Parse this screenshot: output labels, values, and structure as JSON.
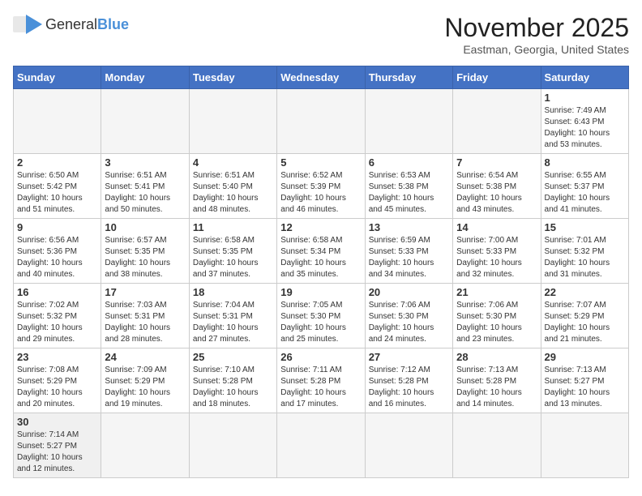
{
  "logo": {
    "text_general": "General",
    "text_blue": "Blue"
  },
  "title": "November 2025",
  "subtitle": "Eastman, Georgia, United States",
  "weekdays": [
    "Sunday",
    "Monday",
    "Tuesday",
    "Wednesday",
    "Thursday",
    "Friday",
    "Saturday"
  ],
  "weeks": [
    [
      {
        "day": "",
        "info": ""
      },
      {
        "day": "",
        "info": ""
      },
      {
        "day": "",
        "info": ""
      },
      {
        "day": "",
        "info": ""
      },
      {
        "day": "",
        "info": ""
      },
      {
        "day": "",
        "info": ""
      },
      {
        "day": "1",
        "info": "Sunrise: 7:49 AM\nSunset: 6:43 PM\nDaylight: 10 hours\nand 53 minutes."
      }
    ],
    [
      {
        "day": "2",
        "info": "Sunrise: 6:50 AM\nSunset: 5:42 PM\nDaylight: 10 hours\nand 51 minutes."
      },
      {
        "day": "3",
        "info": "Sunrise: 6:51 AM\nSunset: 5:41 PM\nDaylight: 10 hours\nand 50 minutes."
      },
      {
        "day": "4",
        "info": "Sunrise: 6:51 AM\nSunset: 5:40 PM\nDaylight: 10 hours\nand 48 minutes."
      },
      {
        "day": "5",
        "info": "Sunrise: 6:52 AM\nSunset: 5:39 PM\nDaylight: 10 hours\nand 46 minutes."
      },
      {
        "day": "6",
        "info": "Sunrise: 6:53 AM\nSunset: 5:38 PM\nDaylight: 10 hours\nand 45 minutes."
      },
      {
        "day": "7",
        "info": "Sunrise: 6:54 AM\nSunset: 5:38 PM\nDaylight: 10 hours\nand 43 minutes."
      },
      {
        "day": "8",
        "info": "Sunrise: 6:55 AM\nSunset: 5:37 PM\nDaylight: 10 hours\nand 41 minutes."
      }
    ],
    [
      {
        "day": "9",
        "info": "Sunrise: 6:56 AM\nSunset: 5:36 PM\nDaylight: 10 hours\nand 40 minutes."
      },
      {
        "day": "10",
        "info": "Sunrise: 6:57 AM\nSunset: 5:35 PM\nDaylight: 10 hours\nand 38 minutes."
      },
      {
        "day": "11",
        "info": "Sunrise: 6:58 AM\nSunset: 5:35 PM\nDaylight: 10 hours\nand 37 minutes."
      },
      {
        "day": "12",
        "info": "Sunrise: 6:58 AM\nSunset: 5:34 PM\nDaylight: 10 hours\nand 35 minutes."
      },
      {
        "day": "13",
        "info": "Sunrise: 6:59 AM\nSunset: 5:33 PM\nDaylight: 10 hours\nand 34 minutes."
      },
      {
        "day": "14",
        "info": "Sunrise: 7:00 AM\nSunset: 5:33 PM\nDaylight: 10 hours\nand 32 minutes."
      },
      {
        "day": "15",
        "info": "Sunrise: 7:01 AM\nSunset: 5:32 PM\nDaylight: 10 hours\nand 31 minutes."
      }
    ],
    [
      {
        "day": "16",
        "info": "Sunrise: 7:02 AM\nSunset: 5:32 PM\nDaylight: 10 hours\nand 29 minutes."
      },
      {
        "day": "17",
        "info": "Sunrise: 7:03 AM\nSunset: 5:31 PM\nDaylight: 10 hours\nand 28 minutes."
      },
      {
        "day": "18",
        "info": "Sunrise: 7:04 AM\nSunset: 5:31 PM\nDaylight: 10 hours\nand 27 minutes."
      },
      {
        "day": "19",
        "info": "Sunrise: 7:05 AM\nSunset: 5:30 PM\nDaylight: 10 hours\nand 25 minutes."
      },
      {
        "day": "20",
        "info": "Sunrise: 7:06 AM\nSunset: 5:30 PM\nDaylight: 10 hours\nand 24 minutes."
      },
      {
        "day": "21",
        "info": "Sunrise: 7:06 AM\nSunset: 5:30 PM\nDaylight: 10 hours\nand 23 minutes."
      },
      {
        "day": "22",
        "info": "Sunrise: 7:07 AM\nSunset: 5:29 PM\nDaylight: 10 hours\nand 21 minutes."
      }
    ],
    [
      {
        "day": "23",
        "info": "Sunrise: 7:08 AM\nSunset: 5:29 PM\nDaylight: 10 hours\nand 20 minutes."
      },
      {
        "day": "24",
        "info": "Sunrise: 7:09 AM\nSunset: 5:29 PM\nDaylight: 10 hours\nand 19 minutes."
      },
      {
        "day": "25",
        "info": "Sunrise: 7:10 AM\nSunset: 5:28 PM\nDaylight: 10 hours\nand 18 minutes."
      },
      {
        "day": "26",
        "info": "Sunrise: 7:11 AM\nSunset: 5:28 PM\nDaylight: 10 hours\nand 17 minutes."
      },
      {
        "day": "27",
        "info": "Sunrise: 7:12 AM\nSunset: 5:28 PM\nDaylight: 10 hours\nand 16 minutes."
      },
      {
        "day": "28",
        "info": "Sunrise: 7:13 AM\nSunset: 5:28 PM\nDaylight: 10 hours\nand 14 minutes."
      },
      {
        "day": "29",
        "info": "Sunrise: 7:13 AM\nSunset: 5:27 PM\nDaylight: 10 hours\nand 13 minutes."
      }
    ],
    [
      {
        "day": "30",
        "info": "Sunrise: 7:14 AM\nSunset: 5:27 PM\nDaylight: 10 hours\nand 12 minutes."
      },
      {
        "day": "",
        "info": ""
      },
      {
        "day": "",
        "info": ""
      },
      {
        "day": "",
        "info": ""
      },
      {
        "day": "",
        "info": ""
      },
      {
        "day": "",
        "info": ""
      },
      {
        "day": "",
        "info": ""
      }
    ]
  ]
}
